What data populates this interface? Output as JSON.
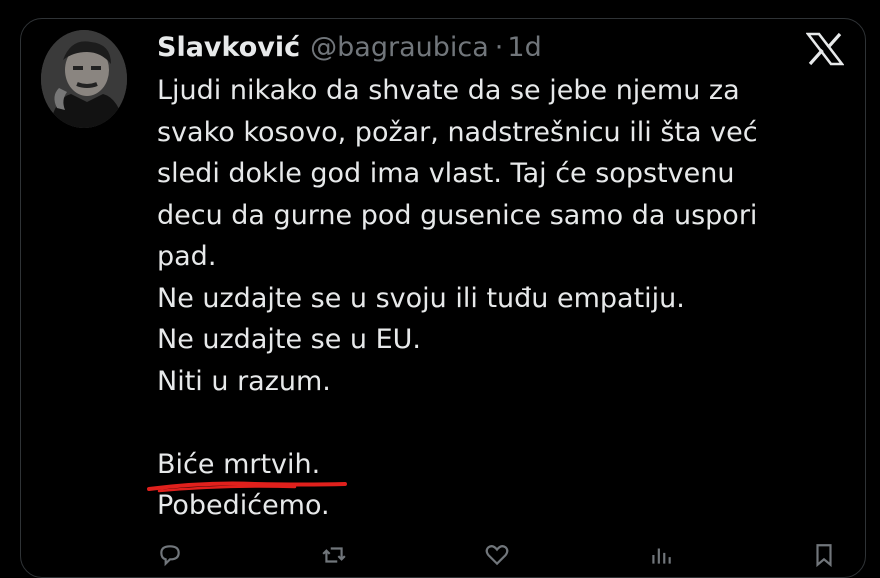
{
  "tweet": {
    "author_name": "Slavković",
    "author_handle": "@bagraubica",
    "separator": "·",
    "time": "1d",
    "lines": [
      "Ljudi nikako da shvate da se jebe njemu za",
      "svako kosovo, požar, nadstrešnicu ili šta već",
      "sledi dokle god ima vlast. Taj će sopstvenu",
      "decu da gurne pod gusenice samo da uspori",
      "pad.",
      "Ne uzdajte se u svoju ili tuđu empatiju.",
      "Ne uzdajte se u EU.",
      "Niti u razum."
    ],
    "highlighted_line": "Biće mrtvih.",
    "last_line": "Pobedićemo."
  },
  "icons": {
    "platform_logo": "x-logo-icon",
    "avatar": "avatar",
    "reply": "reply-icon",
    "retweet": "retweet-icon",
    "like": "like-icon",
    "views": "views-icon",
    "bookmark": "bookmark-icon"
  },
  "colors": {
    "background": "#000000",
    "text": "#e7e9ea",
    "muted": "#71767b",
    "underline": "#e0201c"
  }
}
